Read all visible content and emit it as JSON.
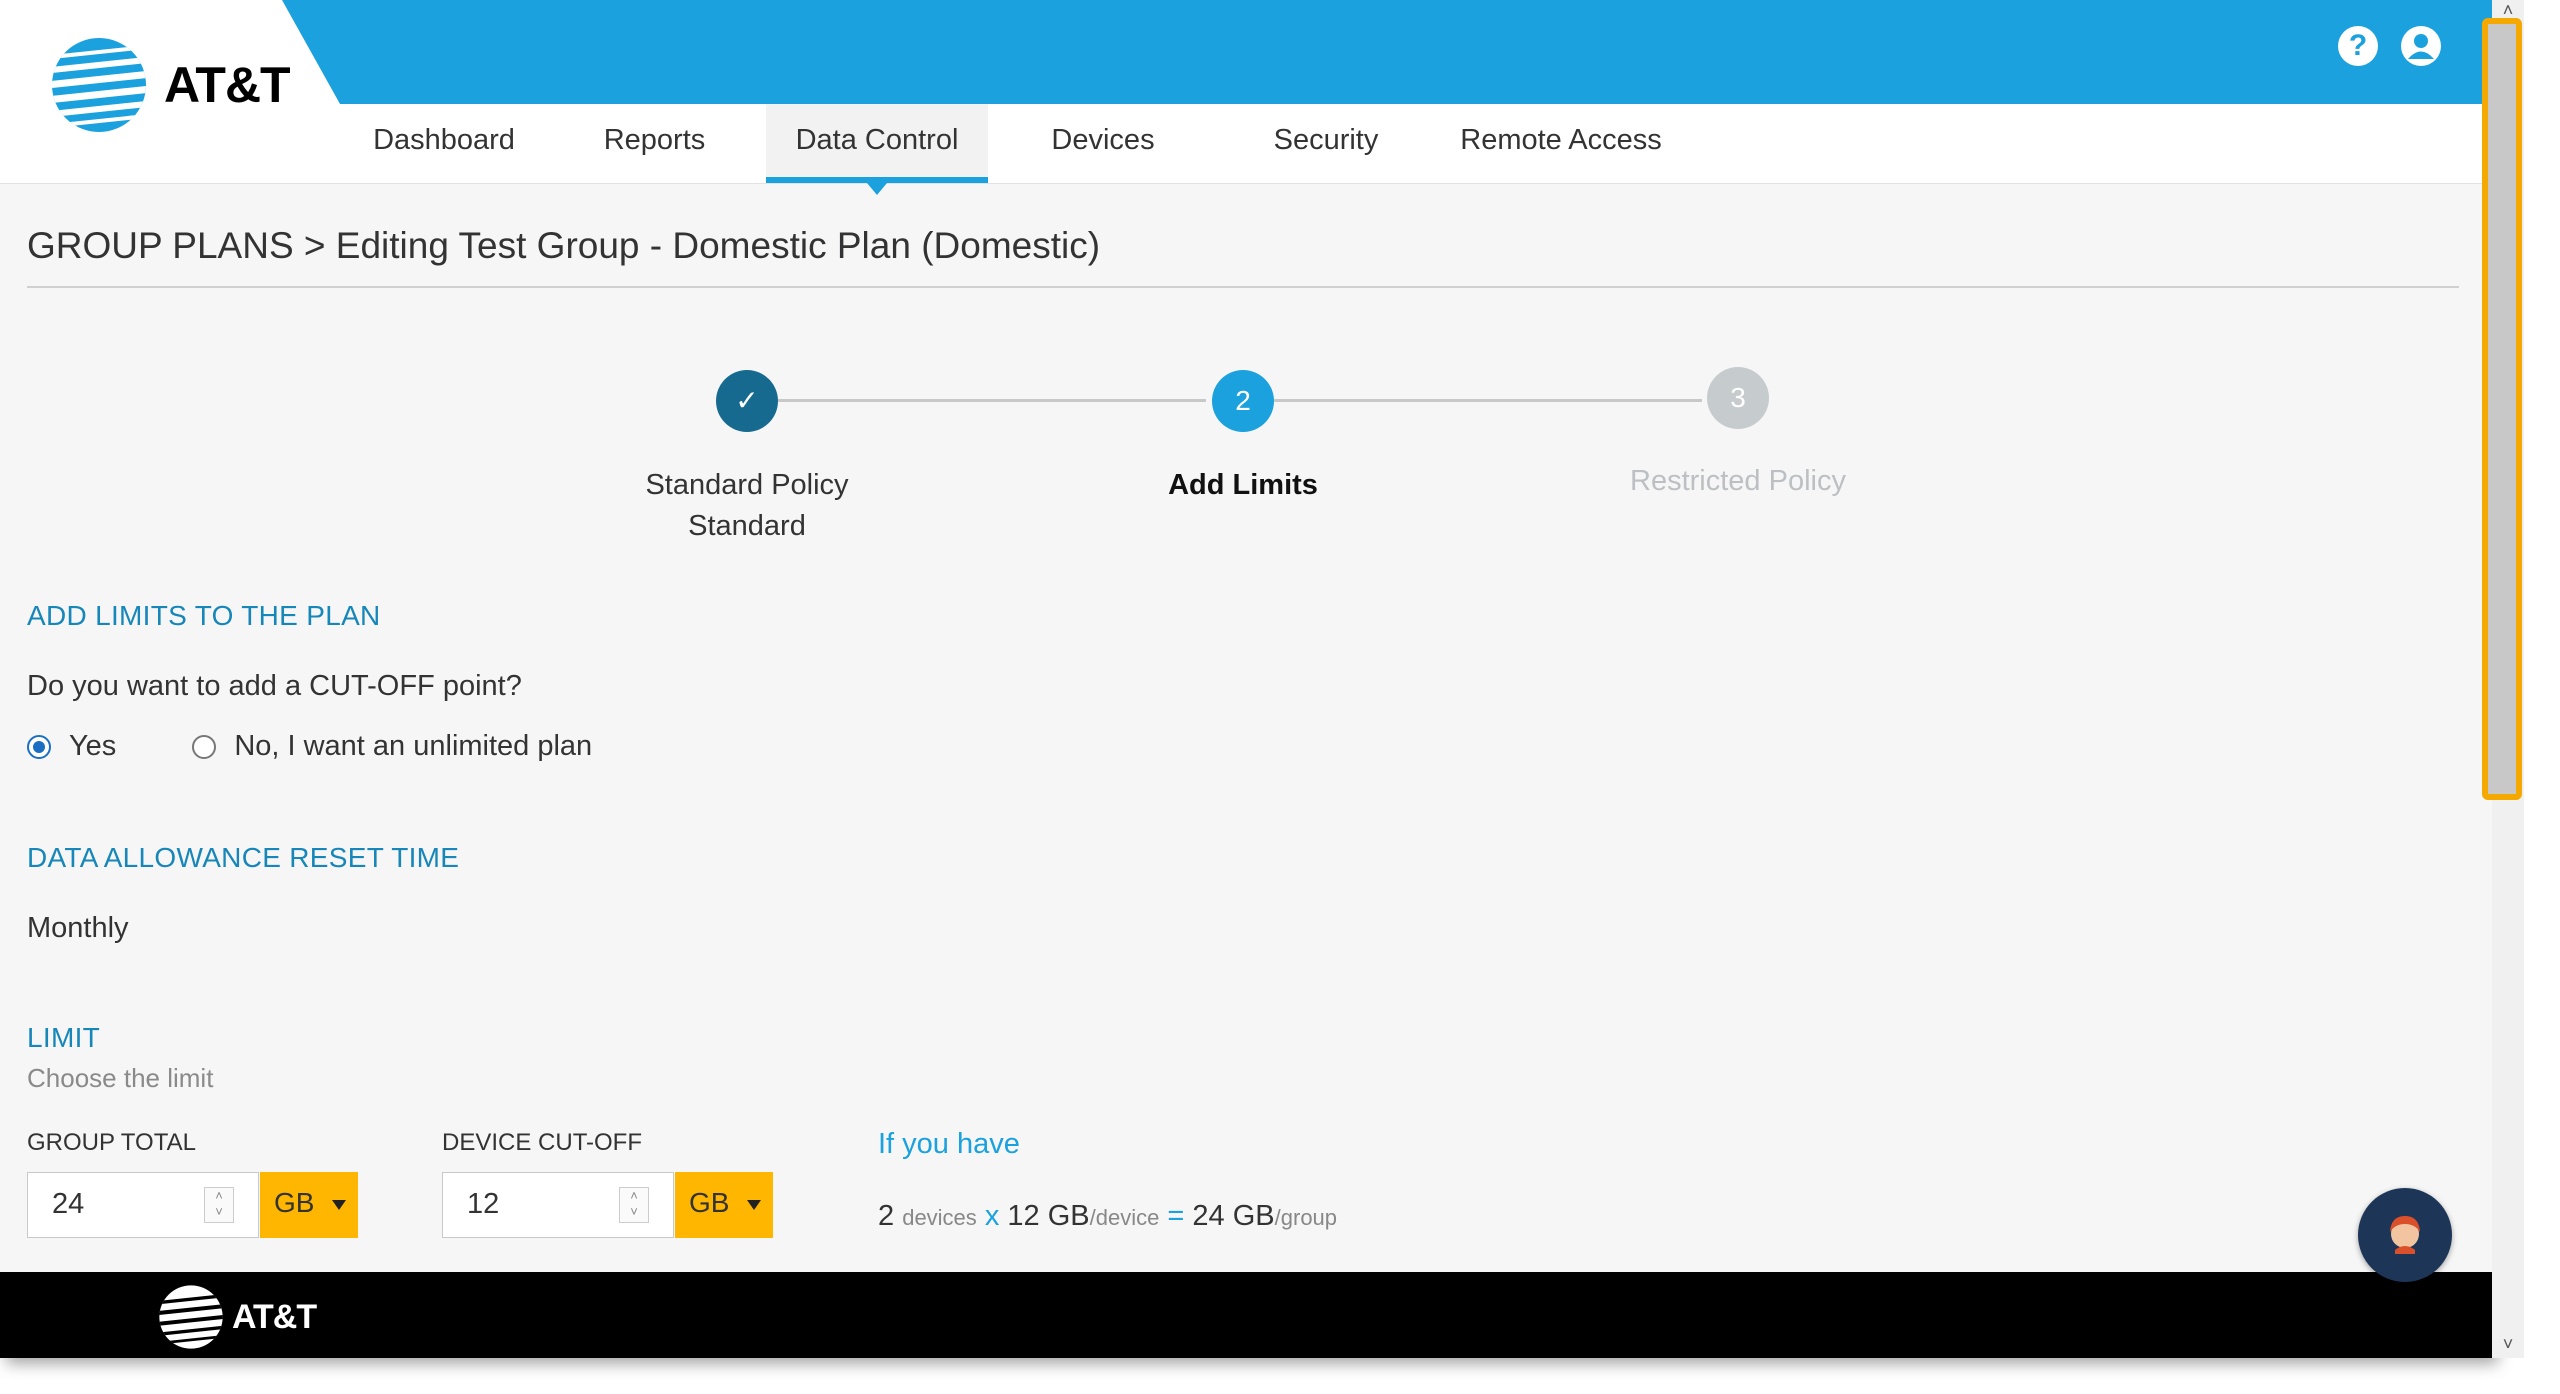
{
  "brand": {
    "name": "AT&T",
    "accent": "#1ba1dd",
    "cta": "#ffb600"
  },
  "header": {
    "icons": [
      "help-icon",
      "account-icon"
    ],
    "nav": [
      {
        "label": "Dashboard",
        "active": false
      },
      {
        "label": "Reports",
        "active": false
      },
      {
        "label": "Data Control",
        "active": true
      },
      {
        "label": "Devices",
        "active": false
      },
      {
        "label": "Security",
        "active": false
      },
      {
        "label": "Remote Access",
        "active": false
      }
    ]
  },
  "page": {
    "breadcrumb": "GROUP PLANS > Editing Test Group - Domestic Plan (Domestic)"
  },
  "stepper": {
    "steps": [
      {
        "number": "✓",
        "label": "Standard Policy",
        "sublabel": "Standard",
        "state": "done"
      },
      {
        "number": "2",
        "label": "Add Limits",
        "sublabel": "",
        "state": "current"
      },
      {
        "number": "3",
        "label": "Restricted Policy",
        "sublabel": "",
        "state": "upcoming"
      }
    ]
  },
  "limits_section": {
    "title": "ADD LIMITS TO THE PLAN",
    "question": "Do you want to add a CUT-OFF point?",
    "options": [
      {
        "label": "Yes",
        "selected": true
      },
      {
        "label": "No, I want an unlimited plan",
        "selected": false
      }
    ]
  },
  "reset_section": {
    "title": "DATA ALLOWANCE RESET TIME",
    "value": "Monthly"
  },
  "limit_section": {
    "title": "LIMIT",
    "subtitle": "Choose the limit",
    "group_total": {
      "label": "GROUP TOTAL",
      "value": "24",
      "unit": "GB"
    },
    "device_cutoff": {
      "label": "DEVICE CUT-OFF",
      "value": "12",
      "unit": "GB"
    },
    "calc": {
      "heading": "If you have",
      "devices": "2",
      "devices_label": "devices",
      "times": "x",
      "per_device": "12 GB",
      "per_device_label": "/device",
      "equals": "=",
      "total": "24 GB",
      "total_label": "/group"
    }
  },
  "footer": {
    "logo": "AT&T"
  }
}
